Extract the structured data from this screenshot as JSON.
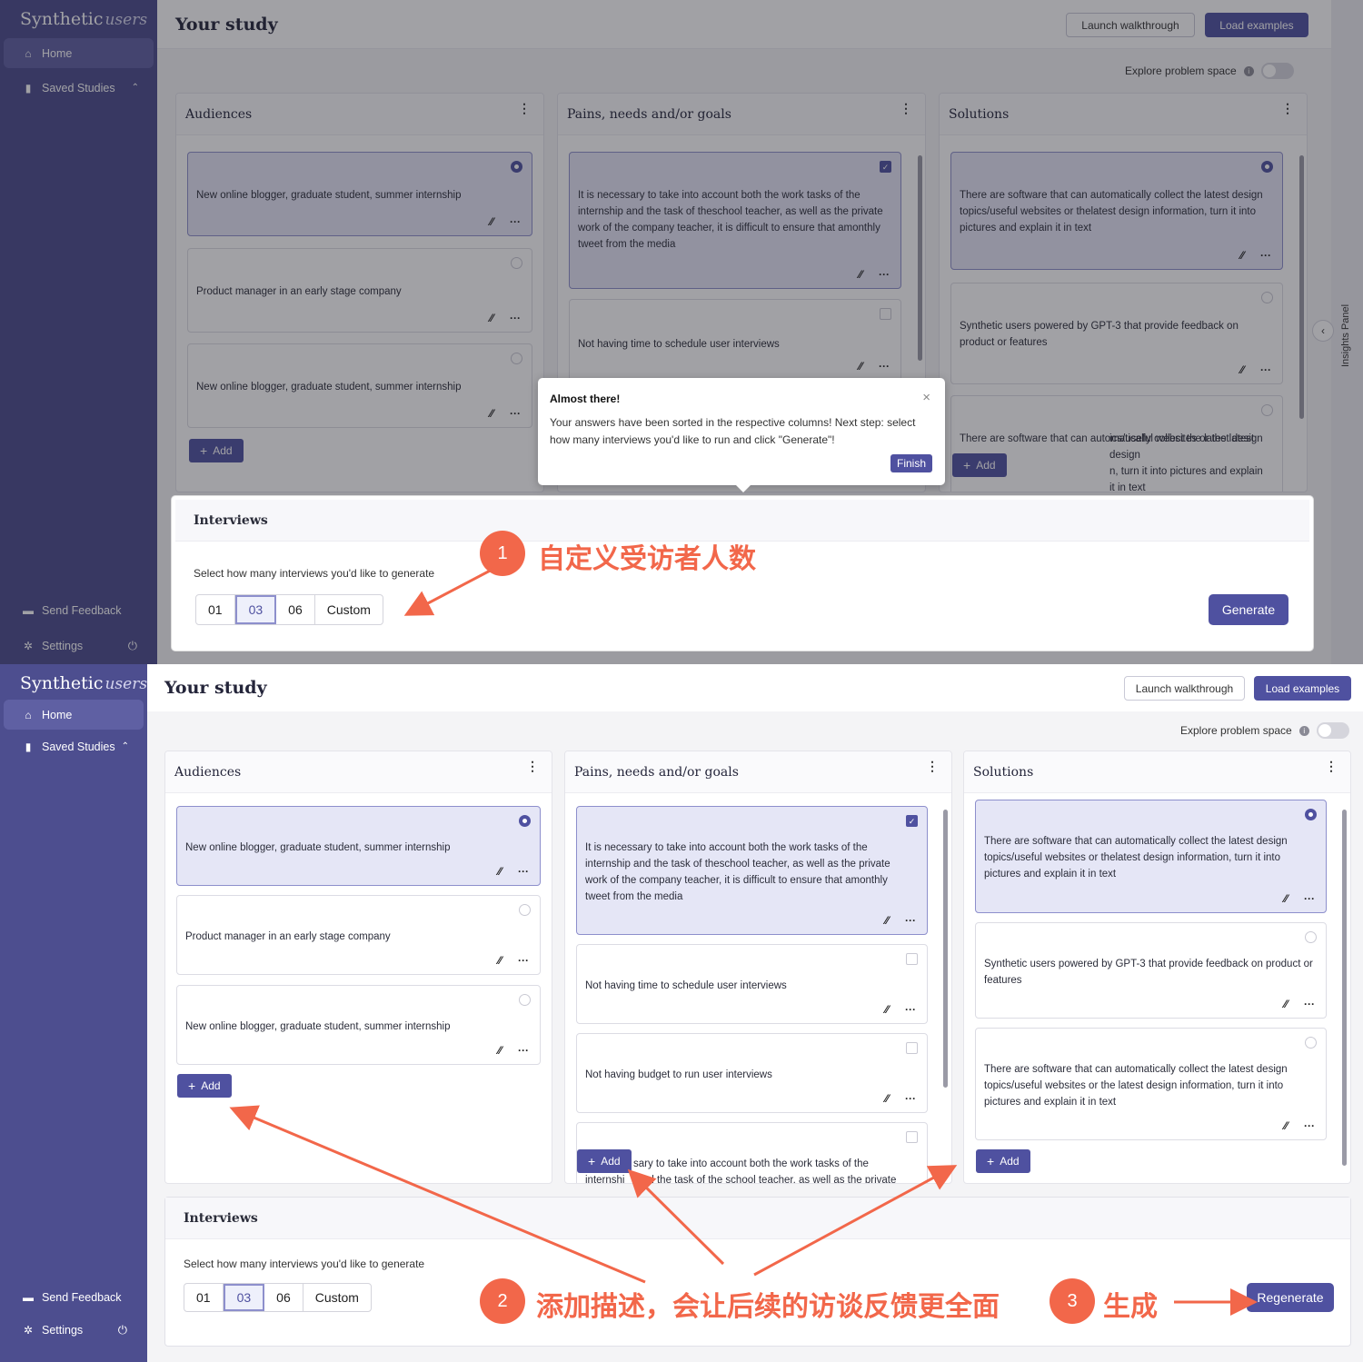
{
  "brand": {
    "name": "Synthetic",
    "script": "users"
  },
  "sidebar": {
    "home": "Home",
    "saved_studies": "Saved Studies",
    "send_feedback": "Send Feedback",
    "settings": "Settings"
  },
  "header": {
    "title": "Your study",
    "launch_walkthrough": "Launch walkthrough",
    "load_examples": "Load examples",
    "explore_problem_space": "Explore problem space"
  },
  "insights_panel": "Insights Panel",
  "audiences": {
    "title": "Audiences",
    "items": [
      "New online blogger, graduate student, summer internship",
      "Product manager in an early stage company",
      "New online blogger, graduate student, summer internship"
    ],
    "add_label": "Add"
  },
  "pains": {
    "title": "Pains, needs and/or goals",
    "items": [
      "It is necessary to take into account both the work tasks of the internship and the task of theschool teacher, as well as the private work of the company teacher, it is difficult to ensure that amonthly tweet from the media",
      "Not having time to schedule user interviews",
      "Not having budget to run user interviews",
      "It is necessary to take into account both the work tasks of the internship and the task of the school teacher, as well as the private"
    ],
    "partial_item_visible": "sary to take into account both the work tasks of the",
    "partial_item_visible_2": "internshi",
    "partial_item_visible_3": "nd the task of the school teacher, as well as the private",
    "add_label": "Add"
  },
  "solutions": {
    "title": "Solutions",
    "items": [
      "There are software that can automatically collect the latest design topics/useful websites or thelatest design information, turn it into pictures and explain it in text",
      "Synthetic users powered by GPT-3 that provide feedback on product or features",
      "There are software that can automatically collect the latest design topics/useful websites or the latest design information, turn it into pictures and explain it in text"
    ],
    "overlay_partial_1": "ics/useful websites or the latest design",
    "overlay_partial_2": "n, turn it into pictures and explain it in text",
    "add_label": "Add"
  },
  "interviews": {
    "title": "Interviews",
    "subtitle": "Select how many interviews you'd like to generate",
    "options": [
      "01",
      "03",
      "06",
      "Custom"
    ],
    "selected": "03",
    "generate": "Generate",
    "regenerate": "Regenerate"
  },
  "tooltip": {
    "title": "Almost there!",
    "body": "Your answers have been sorted in the respective columns! Next step: select how many interviews you'd like to run and click \"Generate\"!",
    "close": "×",
    "finish": "Finish"
  },
  "annotations": {
    "n1": "1",
    "t1": "自定义受访者人数",
    "n2": "2",
    "t2": "添加描述，会让后续的访谈反馈更全面",
    "n3": "3",
    "t3": "生成"
  },
  "colors": {
    "accent": "#4f51a0",
    "sidebar": "#4a4b8c",
    "annotation": "#f2674a"
  }
}
